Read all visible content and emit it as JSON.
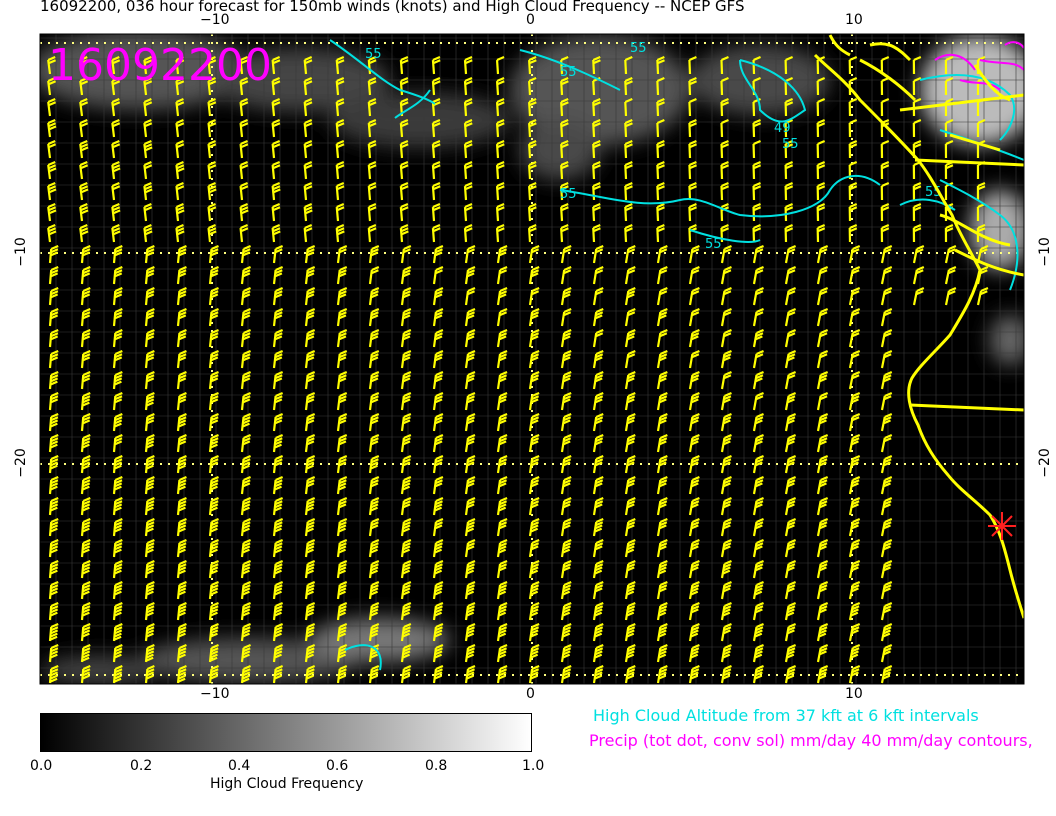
{
  "title": "16092200, 036 hour forecast for 150mb winds (knots) and High Cloud Frequency -- NCEP GFS",
  "stamp": "16092200",
  "axes": {
    "x_top": [
      "−10",
      "0",
      "10"
    ],
    "x_bottom": [
      "−10",
      "0",
      "10"
    ],
    "y_left": [
      "−10",
      "−20"
    ],
    "y_right": [
      "−10",
      "−20"
    ]
  },
  "contour_labels": [
    "55",
    "55",
    "55",
    "55",
    "49",
    "55",
    "55",
    "55"
  ],
  "colorbar": {
    "title": "High Cloud Frequency",
    "ticks": [
      "0.0",
      "0.2",
      "0.4",
      "0.6",
      "0.8",
      "1.0"
    ],
    "min": 0.0,
    "max": 1.0
  },
  "legend": {
    "cloud_altitude": "High Cloud Altitude from 37 kft at 6 kft intervals",
    "precip": "Precip (tot dot, conv sol) mm/day 40 mm/day contours,"
  },
  "colors": {
    "wind_barbs": "#ffff00",
    "coastline": "#ffff00",
    "cloud_altitude_contours": "#00e0e0",
    "precip_contours": "#ff00ff",
    "station_marker": "#ff2020",
    "background": "#000000"
  },
  "marker": "red-star-station"
}
